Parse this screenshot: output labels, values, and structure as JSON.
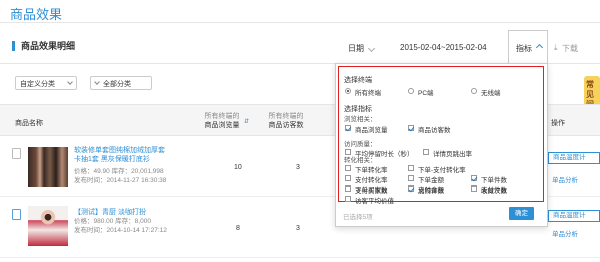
{
  "page_title": "商品效果",
  "section_title": "商品效果明细",
  "toolbar": {
    "date_label": "日期",
    "date_range": "2015-02-04~2015-02-04",
    "metric_label": "指标",
    "download_label": "下载"
  },
  "filters": {
    "category_custom": "自定义分类",
    "category_all": "全部分类"
  },
  "table": {
    "col_name": "商品名称",
    "col_pv_sub": "所有终端的",
    "col_pv": "商品浏览量",
    "col_uv_sub": "所有终端的",
    "col_uv": "商品访客数",
    "col_ops": "操作"
  },
  "rows": [
    {
      "title_line1": "软装修单套图纯棉加绒加厚套",
      "title_line2": "卡抽1套 黑灰保暖打底衫",
      "price": "价格：49.90 库存：20,001,998",
      "published": "发布时间：2014-11-27 16:30:38",
      "pv": "10",
      "uv": "3",
      "btn": "商品温度计",
      "link": "单品分析"
    },
    {
      "title_line1": "【测试】青厨 淡咖打扮",
      "title_line2": "",
      "price": "价格：980.00 库存：8,000",
      "published": "发布时间：2014-10-14 17:27:12",
      "pv": "8",
      "uv": "3",
      "btn": "商品温度计",
      "link": "单品分析"
    }
  ],
  "faq": "常见问题",
  "panel": {
    "terminal_title": "选择终端",
    "terminal_options": [
      "所有终端",
      "PC端",
      "无线端"
    ],
    "terminal_selected": "所有终端",
    "metric_title": "选择指标",
    "browse_title": "浏览相关：",
    "browse_options": [
      {
        "label": "商品浏览量",
        "checked": true
      },
      {
        "label": "商品访客数",
        "checked": true
      }
    ],
    "visit_title": "访问质量：",
    "visit_options": [
      {
        "label": "平均停留时长（秒）",
        "checked": false
      },
      {
        "label": "详情页跳出率",
        "checked": false
      }
    ],
    "convert_title": "转化相关：",
    "convert_options": [
      {
        "label": "下单转化率",
        "checked": false
      },
      {
        "label": "下单-支付转化率",
        "checked": false
      },
      {
        "label": "支付转化率",
        "checked": false
      },
      {
        "label": "下单金额",
        "checked": false
      },
      {
        "label": "下单件数",
        "checked": true
      },
      {
        "label": "下单买家数",
        "checked": false
      },
      {
        "label": "支付金额",
        "checked": true
      },
      {
        "label": "支付件数",
        "checked": false
      },
      {
        "label": "支付买家数",
        "checked": false
      },
      {
        "label": "加购件数",
        "checked": true
      },
      {
        "label": "收藏次数",
        "checked": false
      },
      {
        "label": "访客平均价值",
        "checked": false
      }
    ],
    "selected_count": "已选择5项",
    "confirm": "确定"
  }
}
